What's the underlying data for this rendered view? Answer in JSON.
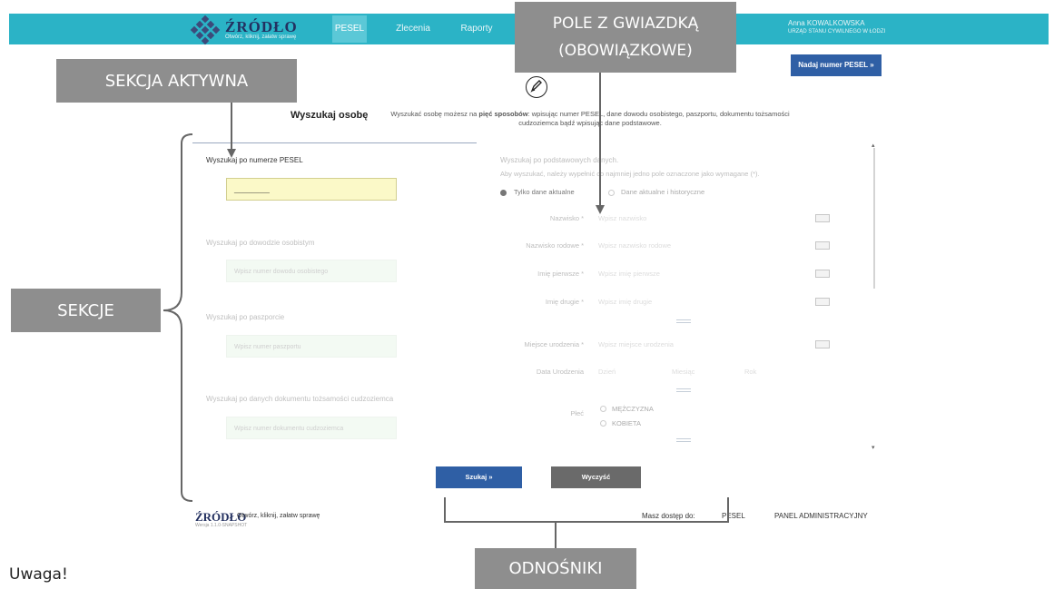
{
  "app": {
    "brand": "ŹRÓDŁO",
    "tagline": "Otwórz, kliknij, załatw sprawę",
    "nav": [
      {
        "label": "PESEL",
        "active": true
      },
      {
        "label": "Zlecenia",
        "active": false
      },
      {
        "label": "Raporty",
        "active": false
      }
    ],
    "user_name": "Anna KOWALKOWSKA",
    "user_role": "URZĄD STANU CYWILNEGO W ŁODZI",
    "nadaj_button": "Nadaj numer PESEL »"
  },
  "callouts": {
    "aktywna": "SEKCJA AKTYWNA",
    "gwiazdka_line1": "POLE Z GWIAZDKĄ",
    "gwiazdka_line2": "(OBOWIĄZKOWE)",
    "sekcje": "SEKCJE",
    "odnosniki": "ODNOŚNIKI"
  },
  "search": {
    "title": "Wyszukaj osobę",
    "description_prefix": "Wyszukać osobę możesz na ",
    "description_bold": "pięć sposobów",
    "description_rest": ": wpisując numer PESEL, dane dowodu osobistego, paszportu, dokumentu tożsamości cudzoziemca bądź wpisując dane podstawowe."
  },
  "sections": [
    {
      "label": "Wyszukaj po numerze PESEL",
      "placeholder": "",
      "value": "__________",
      "active": true
    },
    {
      "label": "Wyszukaj po dowodzie osobistym",
      "placeholder": "Wpisz numer dowodu osobistego",
      "value": "",
      "active": false
    },
    {
      "label": "Wyszukaj po paszporcie",
      "placeholder": "Wpisz numer paszportu",
      "value": "",
      "active": false
    },
    {
      "label": "Wyszukaj po danych dokumentu tożsamości cudzoziemca",
      "placeholder": "Wpisz numer dokumentu cudzoziemca",
      "value": "",
      "active": false
    }
  ],
  "right_form": {
    "heading": "Wyszukaj po podstawowych danych.",
    "hint": "Aby wyszukać, należy wypełnić co najmniej jedno pole oznaczone jako wymagane (*).",
    "radio_current": "Tylko dane aktualne",
    "radio_history": "Dane aktualne i historyczne",
    "fields": [
      {
        "label": "Nazwisko *",
        "placeholder": "Wpisz nazwisko"
      },
      {
        "label": "Nazwisko rodowe *",
        "placeholder": "Wpisz nazwisko rodowe"
      },
      {
        "label": "Imię pierwsze *",
        "placeholder": "Wpisz imię pierwsze"
      },
      {
        "label": "Imię drugie *",
        "placeholder": "Wpisz imię drugie"
      },
      {
        "label": "Miejsce urodzenia *",
        "placeholder": "Wpisz miejsce urodzenia"
      }
    ],
    "birth_date_label": "Data Urodzenia",
    "birth_date_day": "Dzień",
    "birth_date_month": "Miesiąc",
    "birth_date_year": "Rok",
    "sex_label": "Płeć",
    "sex_male": "MĘŻCZYZNA",
    "sex_female": "KOBIETA"
  },
  "buttons": {
    "search": "Szukaj »",
    "clear": "Wyczyść"
  },
  "footer": {
    "brand": "ŹRÓDŁO",
    "tagline": "Otwórz, kliknij, załatw sprawę",
    "version": "Wersja 1.1.0-SNAPSHOT",
    "access_label": "Masz dostęp do:",
    "link_pesel": "PESEL",
    "link_admin": "PANEL ADMINISTRACYJNY"
  },
  "note": "Uwaga!"
}
